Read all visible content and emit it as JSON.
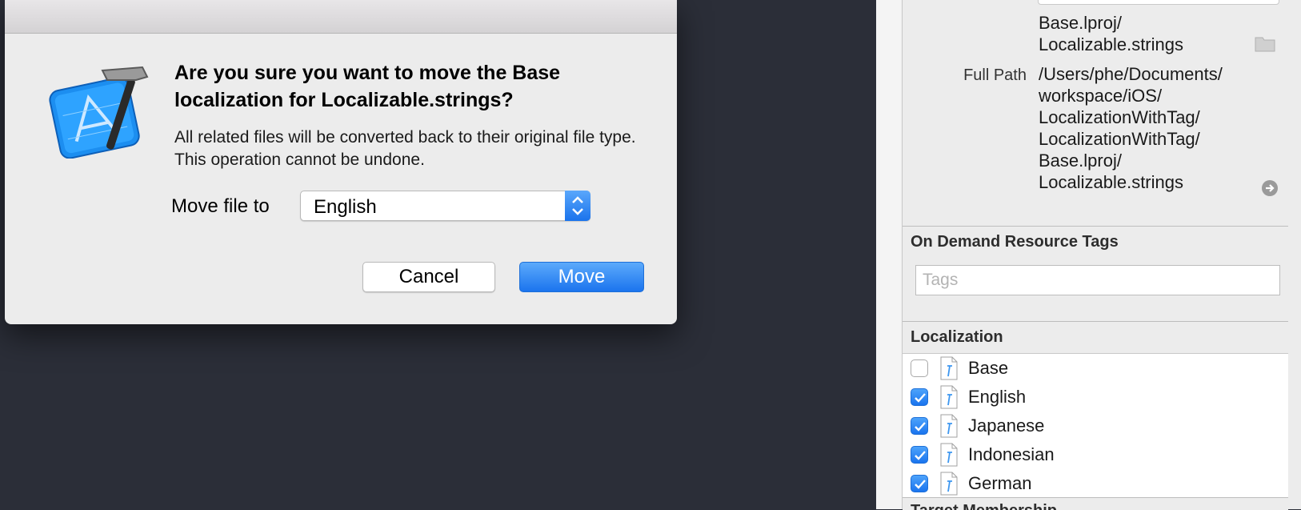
{
  "dialog": {
    "title": "Are you sure you want to move the Base localization for Localizable.strings?",
    "message": "All related files will be converted back to their original file type. This operation cannot be undone.",
    "move_label": "Move file to",
    "move_target": "English",
    "cancel_label": "Cancel",
    "move_button_label": "Move",
    "app_icon": "xcode-icon"
  },
  "inspector": {
    "location_lines": [
      "Base.lproj/",
      "Localizable.strings"
    ],
    "full_path_label": "Full Path",
    "full_path_lines": [
      "/Users/phe/Documents/",
      "workspace/iOS/",
      "LocalizationWithTag/",
      "LocalizationWithTag/",
      "Base.lproj/",
      "Localizable.strings"
    ],
    "odr_header": "On Demand Resource Tags",
    "tags_placeholder": "Tags",
    "localization_header": "Localization",
    "localizations": [
      {
        "label": "Base",
        "checked": false
      },
      {
        "label": "English",
        "checked": true
      },
      {
        "label": "Japanese",
        "checked": true
      },
      {
        "label": "Indonesian",
        "checked": true
      },
      {
        "label": "German",
        "checked": true
      }
    ],
    "next_section_fragment": "Target Membership"
  },
  "colors": {
    "accent": "#1a74ee",
    "desktop": "#2b2e38",
    "panel": "#ececec"
  }
}
